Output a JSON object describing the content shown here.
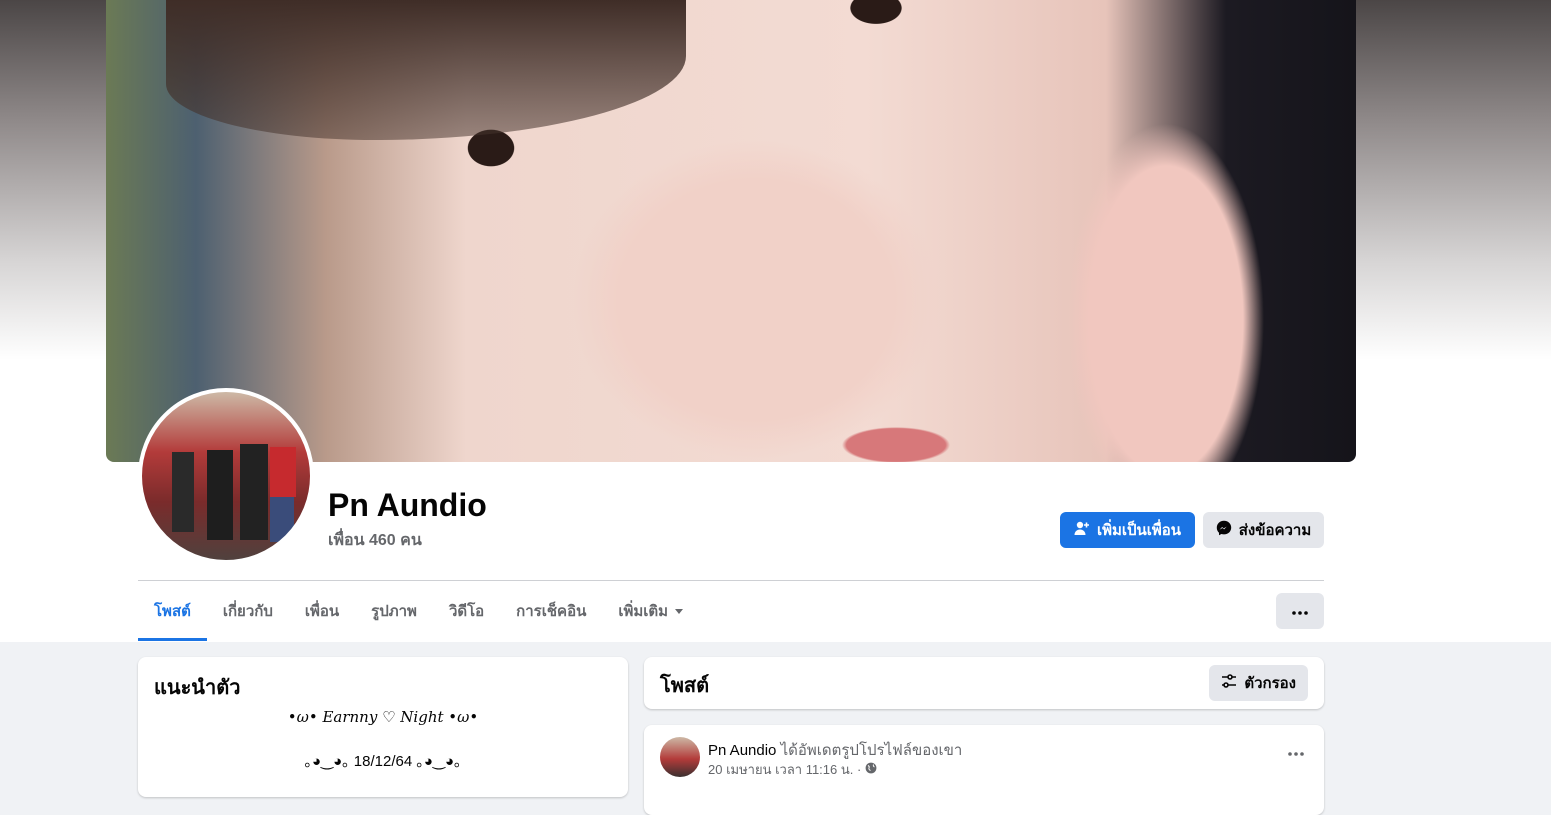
{
  "profile": {
    "name": "Pn Aundio",
    "friends": "เพื่อน 460 คน"
  },
  "actions": {
    "add_friend": "เพิ่มเป็นเพื่อน",
    "message": "ส่งข้อความ"
  },
  "tabs": [
    {
      "label": "โพสต์",
      "active": true
    },
    {
      "label": "เกี่ยวกับ"
    },
    {
      "label": "เพื่อน"
    },
    {
      "label": "รูปภาพ"
    },
    {
      "label": "วิดีโอ"
    },
    {
      "label": "การเช็คอิน"
    },
    {
      "label": "เพิ่มเติม"
    }
  ],
  "intro": {
    "title": "แนะนำตัว",
    "line1": "•ω• Earnny ♡ Night •ω•",
    "line2": "｡◕‿◕｡ 18/12/64 ｡◕‿◕｡"
  },
  "posts": {
    "title": "โพสต์",
    "filter_label": "ตัวกรอง"
  },
  "post": {
    "author": "Pn Aundio",
    "action": "ได้อัพเดตรูปโปรไฟล์ของเขา",
    "time": "20 เมษายน เวลา 11:16 น. ·"
  },
  "colors": {
    "accent": "#1b74e4",
    "background": "#f0f2f5",
    "muted_text": "#65676b",
    "button_gray": "#e4e6eb"
  }
}
